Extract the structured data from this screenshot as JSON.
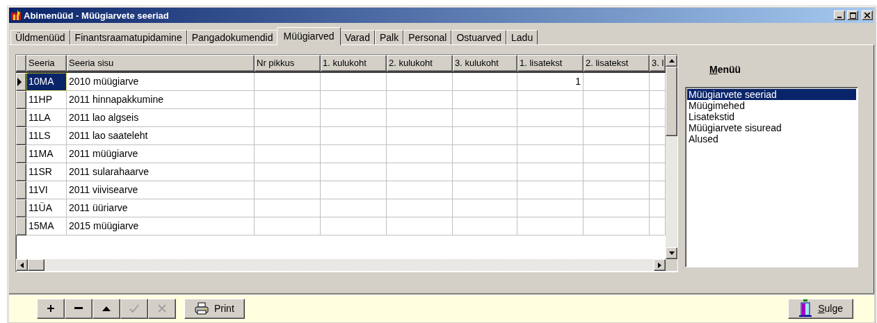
{
  "window": {
    "title": "Abimenüüd - Müügiarvete seeriad"
  },
  "tabs": [
    {
      "label": "Üldmenüüd",
      "selected": false
    },
    {
      "label": "Finantsraamatupidamine",
      "selected": false
    },
    {
      "label": "Pangadokumendid",
      "selected": false
    },
    {
      "label": "Müügiarved",
      "selected": true
    },
    {
      "label": "Varad",
      "selected": false
    },
    {
      "label": "Palk",
      "selected": false
    },
    {
      "label": "Personal",
      "selected": false
    },
    {
      "label": "Ostuarved",
      "selected": false
    },
    {
      "label": "Ladu",
      "selected": false
    }
  ],
  "table": {
    "columns": [
      "Seeria",
      "Seeria sisu",
      "Nr pikkus",
      "1. kulukoht",
      "2. kulukoht",
      "3. kulukoht",
      "1. lisatekst",
      "2. lisatekst",
      "3. l"
    ],
    "rows": [
      {
        "selected": true,
        "cells": [
          "10MA",
          "2010 müügiarve",
          "",
          "",
          "",
          "",
          "1",
          "",
          ""
        ]
      },
      {
        "selected": false,
        "cells": [
          "11HP",
          "2011 hinnapakkumine",
          "",
          "",
          "",
          "",
          "",
          "",
          ""
        ]
      },
      {
        "selected": false,
        "cells": [
          "11LA",
          "2011 lao algseis",
          "",
          "",
          "",
          "",
          "",
          "",
          ""
        ]
      },
      {
        "selected": false,
        "cells": [
          "11LS",
          "2011 lao saateleht",
          "",
          "",
          "",
          "",
          "",
          "",
          ""
        ]
      },
      {
        "selected": false,
        "cells": [
          "11MA",
          "2011 müügiarve",
          "",
          "",
          "",
          "",
          "",
          "",
          ""
        ]
      },
      {
        "selected": false,
        "cells": [
          "11SR",
          "2011 sularahaarve",
          "",
          "",
          "",
          "",
          "",
          "",
          ""
        ]
      },
      {
        "selected": false,
        "cells": [
          "11VI",
          "2011 viivisearve",
          "",
          "",
          "",
          "",
          "",
          "",
          ""
        ]
      },
      {
        "selected": false,
        "cells": [
          "11ÜA",
          "2011 üüriarve",
          "",
          "",
          "",
          "",
          "",
          "",
          ""
        ]
      },
      {
        "selected": false,
        "cells": [
          "15MA",
          "2015 müügiarve",
          "",
          "",
          "",
          "",
          "",
          "",
          ""
        ]
      }
    ]
  },
  "menu": {
    "title": "Menüü",
    "items": [
      {
        "label": "Müügiarvete seeriad",
        "selected": true
      },
      {
        "label": "Müügimehed",
        "selected": false
      },
      {
        "label": "Lisatekstid",
        "selected": false
      },
      {
        "label": "Müügiarvete sisuread",
        "selected": false
      },
      {
        "label": "Alused",
        "selected": false
      }
    ]
  },
  "toolbar": {
    "nav_buttons": [
      {
        "kind": "add",
        "disabled": false
      },
      {
        "kind": "remove",
        "disabled": false
      },
      {
        "kind": "up",
        "disabled": false
      },
      {
        "kind": "confirm",
        "disabled": true
      },
      {
        "kind": "cancel",
        "disabled": true
      }
    ],
    "print_button": {
      "label": "Print"
    },
    "close_button": {
      "label": "Sulge"
    }
  }
}
